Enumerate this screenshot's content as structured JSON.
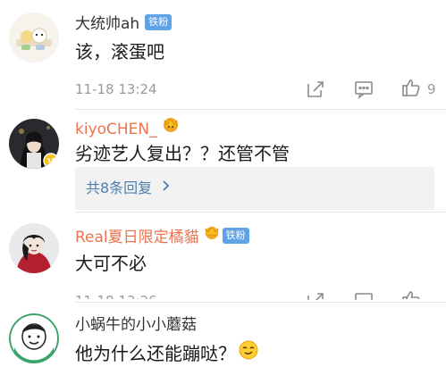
{
  "comments": [
    {
      "username": "大统帅ah",
      "badge": "铁粉",
      "text": "该，滚蛋吧",
      "time": "11-18 13:24",
      "likes": "9"
    },
    {
      "username": "kiyoCHEN_",
      "text": "劣迹艺人复出？？还管不管",
      "replies_label": "共8条回复"
    },
    {
      "username": "Real夏日限定橘貓",
      "badge": "铁粉",
      "text": "大可不必",
      "time": "11-18 13:26"
    },
    {
      "username": "小蜗牛的小小蘑菇",
      "text": "他为什么还能蹦哒？"
    }
  ],
  "icons": {
    "share": "share-icon",
    "comment": "comment-icon",
    "like": "like-icon",
    "chevron": "chevron-right-icon",
    "vip_crown": "vip-crown-icon",
    "emoji": "smirk-emoji-icon"
  },
  "colors": {
    "vip_name": "#eb7350",
    "link": "#507daf",
    "badge": "#5fa3e6",
    "meta": "#9a9a9a"
  }
}
